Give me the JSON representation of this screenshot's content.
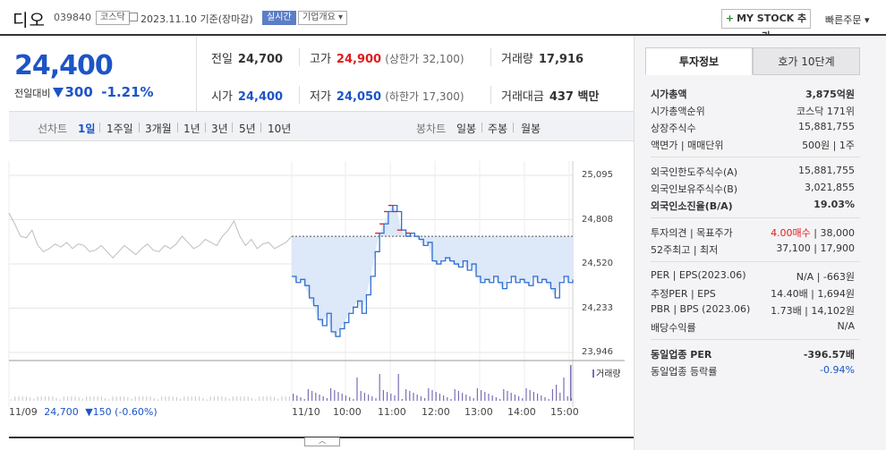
{
  "header": {
    "name": "디오",
    "code": "039840",
    "market": "코스닥",
    "date": "2023.11.10",
    "date_suffix": "기준(장마감)",
    "realtime": "실시간",
    "company_info": "기업개요 ▾",
    "mystock": "MY STOCK 추가",
    "quick_order": "빠른주문 ▾"
  },
  "price": {
    "current": "24,400",
    "change_label": "전일대비",
    "change": "300",
    "change_pct": "-1.21%",
    "color": "#1d54c6"
  },
  "stats": {
    "prev_label": "전일",
    "prev": "24,700",
    "high_label": "고가",
    "high": "24,900",
    "upper_limit": "(상한가 32,100)",
    "volume_label": "거래량",
    "volume": "17,916",
    "open_label": "시가",
    "open": "24,400",
    "low_label": "저가",
    "low": "24,050",
    "lower_limit": "(하한가 17,300)",
    "amount_label": "거래대금",
    "amount": "437 백만"
  },
  "period_bar": {
    "label": "선차트",
    "options": [
      "1일",
      "1주일",
      "3개월",
      "1년",
      "3년",
      "5년",
      "10년"
    ],
    "selected": "1일",
    "candle_label": "봉차트",
    "candle_options": [
      "일봉",
      "주봉",
      "월봉"
    ]
  },
  "chart_data": {
    "type": "line",
    "y_ticks": [
      "25,095",
      "24,808",
      "24,520",
      "24,233",
      "23,946"
    ],
    "ylim": [
      23946,
      25095
    ],
    "x_ticks": [
      "11/10",
      "10:00",
      "11:00",
      "12:00",
      "13:00",
      "14:00",
      "15:00"
    ],
    "prev_day_label": "11/09",
    "prev_day_close": "24,700",
    "prev_day_change": "▼150 (-0.60%)",
    "reference_price": 24700,
    "volume_legend": "거래량",
    "series": [
      {
        "name": "11/09",
        "values": [
          24850,
          24780,
          24700,
          24690,
          24740,
          24640,
          24600,
          24620,
          24650,
          24630,
          24660,
          24620,
          24650,
          24640,
          24600,
          24610,
          24640,
          24600,
          24560,
          24600,
          24640,
          24610,
          24580,
          24620,
          24650,
          24610,
          24600,
          24640,
          24620,
          24650,
          24700,
          24660,
          24620,
          24640,
          24680,
          24660,
          24640,
          24700,
          24740,
          24800,
          24700,
          24640,
          24680,
          24620,
          24650,
          24660,
          24620,
          24640,
          24660,
          24700
        ]
      },
      {
        "name": "11/10",
        "values": [
          24440,
          24400,
          24420,
          24380,
          24300,
          24250,
          24160,
          24120,
          24200,
          24080,
          24050,
          24100,
          24140,
          24200,
          24240,
          24280,
          24200,
          24320,
          24440,
          24600,
          24720,
          24780,
          24860,
          24900,
          24860,
          24740,
          24700,
          24720,
          24700,
          24680,
          24640,
          24660,
          24540,
          24520,
          24540,
          24560,
          24540,
          24520,
          24500,
          24540,
          24480,
          24520,
          24440,
          24400,
          24420,
          24400,
          24440,
          24400,
          24360,
          24400,
          24440,
          24400,
          24420,
          24400,
          24380,
          24440,
          24400,
          24420,
          24400,
          24360,
          24300,
          24400,
          24440,
          24400,
          24420
        ]
      }
    ]
  },
  "invest_info": {
    "tab_active": "투자정보",
    "tab_other": "호가 10단계",
    "rows1": [
      {
        "label": "시가총액",
        "value": "3,875억원",
        "bold": true
      },
      {
        "label": "시가총액순위",
        "value": "코스닥 171위"
      },
      {
        "label": "상장주식수",
        "value": "15,881,755"
      },
      {
        "label": "액면가 | 매매단위",
        "value": "500원 | 1주"
      }
    ],
    "rows2": [
      {
        "label": "외국인한도주식수(A)",
        "value": "15,881,755"
      },
      {
        "label": "외국인보유주식수(B)",
        "value": "3,021,855"
      },
      {
        "label": "외국인소진율(B/A)",
        "value": "19.03%",
        "bold": true
      }
    ],
    "rows3": [
      {
        "label": "투자의견 | 목표주가",
        "value_red": "4.00매수",
        "value": "38,000"
      },
      {
        "label": "52주최고 | 최저",
        "value": "37,100 | 17,900"
      }
    ],
    "rows4": [
      {
        "label": "PER | EPS(2023.06)",
        "value": "N/A | -663원"
      },
      {
        "label": "추정PER | EPS",
        "value": "14.40배 | 1,694원"
      },
      {
        "label": "PBR | BPS (2023.06)",
        "value": "1.73배 | 14,102원"
      },
      {
        "label": "배당수익률",
        "value": "N/A"
      }
    ],
    "rows5": [
      {
        "label": "동일업종 PER",
        "value": "-396.57배",
        "bold": true
      },
      {
        "label": "동일업종 등락률",
        "value": "-0.94%",
        "blue": true
      }
    ]
  }
}
